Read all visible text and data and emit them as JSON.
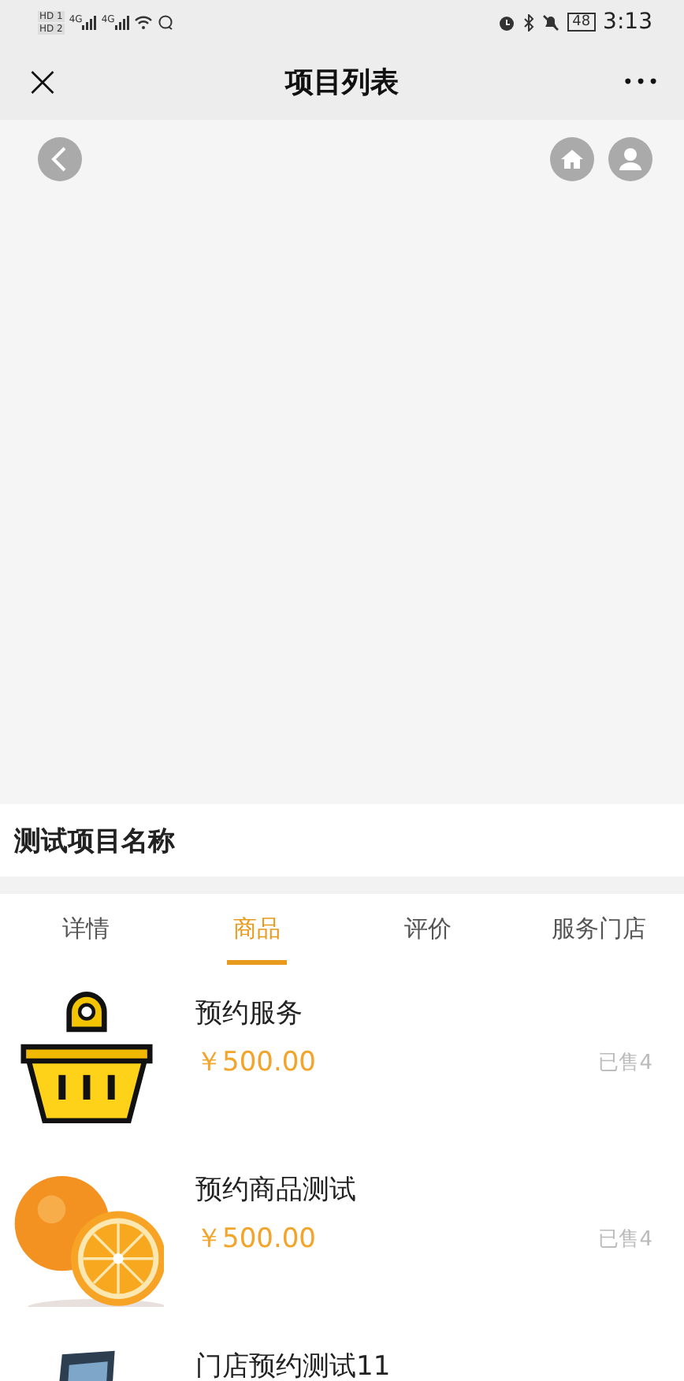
{
  "status_bar": {
    "sim_labels": [
      "HD 1",
      "HD 2"
    ],
    "network": [
      "4G",
      "4G"
    ],
    "battery": "48",
    "time": "3:13"
  },
  "nav_bar": {
    "close": "×",
    "title": "项目列表",
    "more": "•••"
  },
  "project": {
    "name": "测试项目名称"
  },
  "tabs": [
    {
      "label": "详情",
      "selected": false
    },
    {
      "label": "商品",
      "selected": true
    },
    {
      "label": "评价",
      "selected": false
    },
    {
      "label": "服务门店",
      "selected": false
    }
  ],
  "products": [
    {
      "kind": "picture",
      "name": "预约服务",
      "price": "￥500.00",
      "sold": "已售4"
    },
    {
      "kind": "picture",
      "name": "预约商品测试",
      "price": "￥500.00",
      "sold": "已售4"
    },
    {
      "kind": "picture",
      "name": "门店预约测试11"
    }
  ]
}
